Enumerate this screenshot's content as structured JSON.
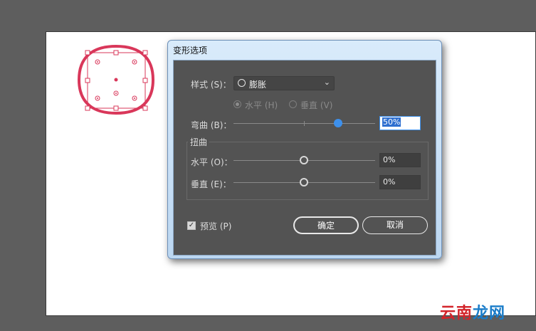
{
  "dialog": {
    "title": "变形选项",
    "style_label": "样式 (S)：",
    "style_value": "膨胀",
    "orientation": {
      "horizontal_label": "水平 (H)",
      "vertical_label": "垂直 (V)",
      "selected": "horizontal"
    },
    "bend_label": "弯曲 (B)：",
    "bend_value": "50%",
    "bend_fraction": 0.75,
    "distortion": {
      "title": "扭曲",
      "horizontal_label": "水平 (O)：",
      "horizontal_value": "0%",
      "vertical_label": "垂直 (E)：",
      "vertical_value": "0%"
    },
    "preview_label": "预览 (P)",
    "preview_checked": true,
    "ok_label": "确定",
    "cancel_label": "取消"
  },
  "watermark": {
    "part1": "云南",
    "part2": "龙网"
  },
  "colors": {
    "accent": "#3d90ec",
    "object_stroke": "#d9375a",
    "panel_bg": "#535353"
  }
}
